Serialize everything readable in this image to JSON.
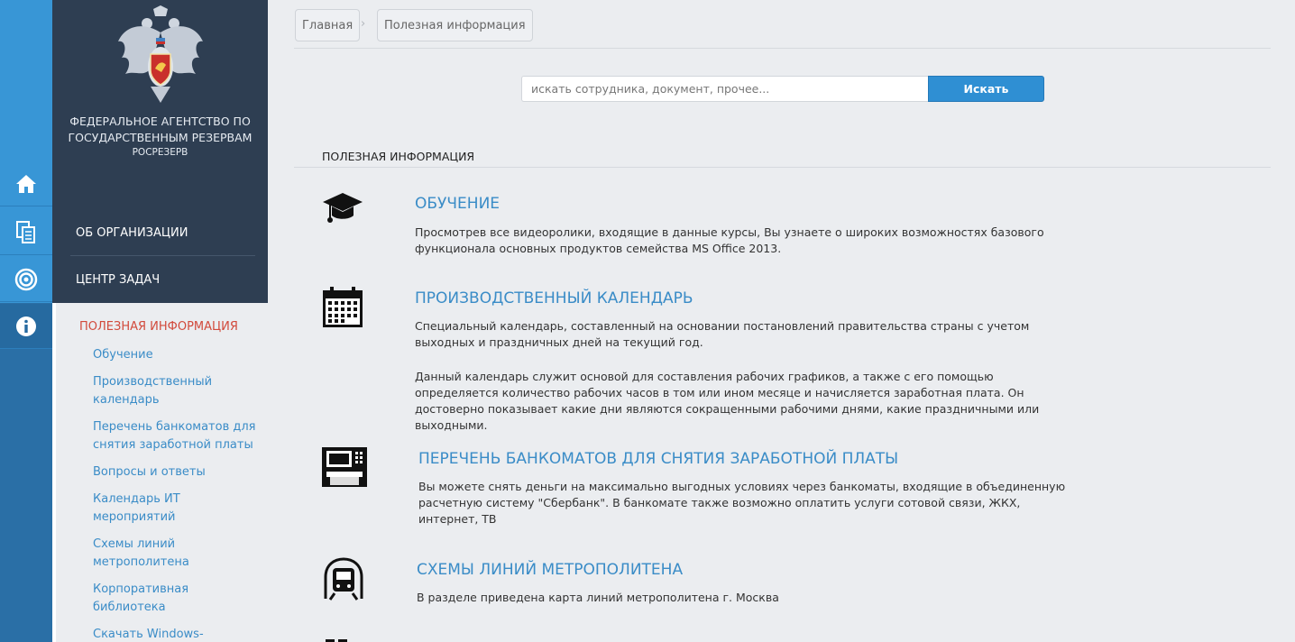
{
  "org": {
    "name": "ФЕДЕРАЛЬНОЕ АГЕНТСТВО ПО ГОСУДАРСТВЕННЫМ РЕЗЕРВАМ",
    "short_name": "РОСРЕЗЕРВ",
    "menu": [
      "ОБ ОРГАНИЗАЦИИ",
      "ЦЕНТР ЗАДАЧ"
    ]
  },
  "rail": {
    "icons": [
      "home-icon",
      "documents-icon",
      "target-icon",
      "info-icon"
    ],
    "active_index": 3
  },
  "submenu": {
    "title": "ПОЛЕЗНАЯ ИНФОРМАЦИЯ",
    "items": [
      "Обучение",
      "Производственный календарь",
      "Перечень банкоматов для снятия заработной платы",
      "Вопросы и ответы",
      "Календарь ИТ мероприятий",
      "Схемы линий метрополитена",
      "Корпоративная библиотека",
      "Скачать Windows-"
    ]
  },
  "breadcrumb": [
    "Главная",
    "Полезная информация"
  ],
  "search": {
    "placeholder": "искать сотрудника, документ, прочее...",
    "button": "Искать"
  },
  "section_title": "ПОЛЕЗНАЯ ИНФОРМАЦИЯ",
  "items": [
    {
      "icon": "graduation-cap-icon",
      "title": "ОБУЧЕНИЕ",
      "paragraphs": [
        "Просмотрев все видеоролики, входящие в данные курсы, Вы узнаете о широких возможностях базового функционала основных продуктов семейства MS Office 2013."
      ]
    },
    {
      "icon": "calendar-icon",
      "title": "ПРОИЗВОДСТВЕННЫЙ КАЛЕНДАРЬ",
      "paragraphs": [
        "Специальный календарь, составленный на основании постановлений правительства страны с учетом выходных и праздничных дней на текущий год.",
        "Данный календарь служит основой для составления рабочих графиков, а также с его помощью определяется количество рабочих часов в том или ином месяце и начисляется заработная плата. Он достоверно показывает какие дни являются сокращенными рабочими днями, какие праздничными или выходными."
      ]
    },
    {
      "icon": "atm-icon",
      "title": "ПЕРЕЧЕНЬ БАНКОМАТОВ ДЛЯ СНЯТИЯ ЗАРАБОТНОЙ ПЛАТЫ",
      "paragraphs": [
        "Вы можете снять деньги на максимально выгодных условиях через банкоматы, входящие в объединенную расчетную систему \"Сбербанк\". В банкомате также возможно оплатить услуги сотовой связи, ЖКХ, интернет, ТВ"
      ]
    },
    {
      "icon": "metro-train-icon",
      "title": "СХЕМЫ ЛИНИЙ МЕТРОПОЛИТЕНА",
      "paragraphs": [
        "В разделе приведена карта линий метрополитена г. Москва"
      ]
    }
  ],
  "colors": {
    "rail": "#3896d6",
    "org_panel": "#2e3e52",
    "link": "#3a8cc7",
    "active_menu": "#d24a3c",
    "button": "#2f8fd3"
  }
}
